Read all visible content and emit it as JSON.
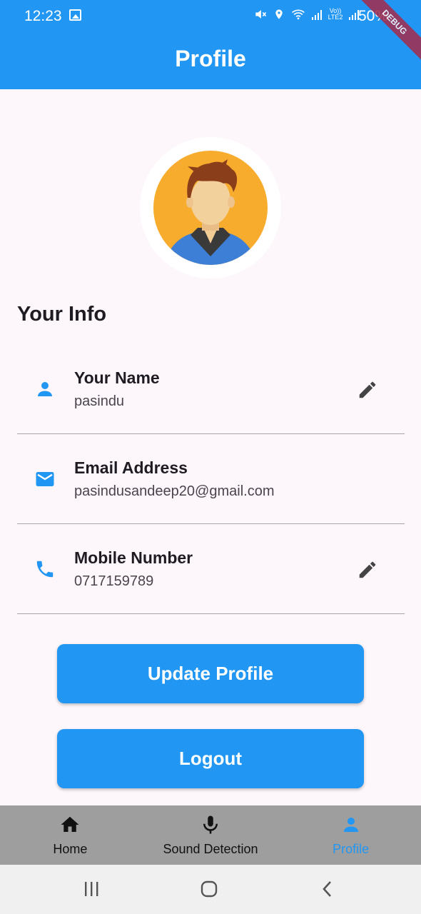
{
  "status_bar": {
    "time": "12:23",
    "battery": "50%",
    "network_label": "Vo)) LTE2"
  },
  "app_bar": {
    "title": "Profile",
    "debug_banner": "DEBUG"
  },
  "profile": {
    "section_title": "Your Info",
    "fields": [
      {
        "label": "Your Name",
        "value": "pasindu",
        "icon": "person-icon",
        "editable": true
      },
      {
        "label": "Email Address",
        "value": "pasindusandeep20@gmail.com",
        "icon": "email-icon",
        "editable": false
      },
      {
        "label": "Mobile Number",
        "value": "0717159789",
        "icon": "phone-icon",
        "editable": true
      }
    ]
  },
  "actions": {
    "update_label": "Update Profile",
    "logout_label": "Logout"
  },
  "bottom_nav": {
    "items": [
      {
        "label": "Home",
        "icon": "home-icon",
        "active": false
      },
      {
        "label": "Sound Detection",
        "icon": "microphone-icon",
        "active": false
      },
      {
        "label": "Profile",
        "icon": "person-icon",
        "active": true
      }
    ]
  },
  "colors": {
    "primary": "#2196f3",
    "background": "#fdf7fc",
    "nav_bg": "#9e9e9e",
    "avatar_bg": "#f8ac2d"
  }
}
